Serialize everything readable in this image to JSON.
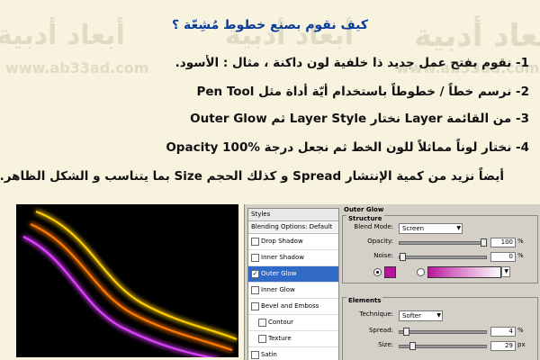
{
  "watermark": {
    "arabic_name": "أبعاد أدبية",
    "url": "www.ab33ad.com"
  },
  "tutorial": {
    "title": "كيف نقوم بصنع خطوط مُشِعّة ؟",
    "steps": [
      "1- نقوم بفتح عمل جديد ذا خلفية لون داكنة ، مثال : الأسود.",
      "2- نرسم خطاً / خطوطاً باستخدام أيّة أداة مثل Pen Tool",
      "3- من القائمة Layer نختار Layer Style ثم Outer Glow",
      "4- نختار لوناً مماثلاً للون الخط ثم نجعل درجة Opacity 100%",
      "أيضاً نزيد من كمية الإنتشار Spread و كذلك الحجم Size بما يتناسب و الشكل الظاهر."
    ]
  },
  "preview": {
    "line_colors": [
      "#ffcc00",
      "#ff7a00",
      "#e040ff"
    ]
  },
  "layer_style": {
    "list_header": "Styles",
    "blending_options": "Blending Options: Default",
    "items": [
      {
        "label": "Drop Shadow",
        "checked": false,
        "selected": false,
        "indent": false
      },
      {
        "label": "Inner Shadow",
        "checked": false,
        "selected": false,
        "indent": false
      },
      {
        "label": "Outer Glow",
        "checked": true,
        "selected": true,
        "indent": false
      },
      {
        "label": "Inner Glow",
        "checked": false,
        "selected": false,
        "indent": false
      },
      {
        "label": "Bevel and Emboss",
        "checked": false,
        "selected": false,
        "indent": false
      },
      {
        "label": "Contour",
        "checked": false,
        "selected": false,
        "indent": true
      },
      {
        "label": "Texture",
        "checked": false,
        "selected": false,
        "indent": true
      },
      {
        "label": "Satin",
        "checked": false,
        "selected": false,
        "indent": false
      }
    ],
    "outer_glow": {
      "panel_title": "Outer Glow",
      "structure_title": "Structure",
      "blend_mode_label": "Blend Mode:",
      "blend_mode_value": "Screen",
      "opacity_label": "Opacity:",
      "opacity_value": "100",
      "opacity_unit": "%",
      "opacity_level": 1.0,
      "noise_label": "Noise:",
      "noise_value": "0",
      "noise_unit": "%",
      "noise_level": 0.0,
      "glow_color": "#b6179a",
      "elements_title": "Elements",
      "technique_label": "Technique:",
      "technique_value": "Softer",
      "spread_label": "Spread:",
      "spread_value": "4",
      "spread_unit": "%",
      "spread_level": 0.04,
      "size_label": "Size:",
      "size_value": "29",
      "size_unit": "px",
      "size_level": 0.12
    }
  }
}
